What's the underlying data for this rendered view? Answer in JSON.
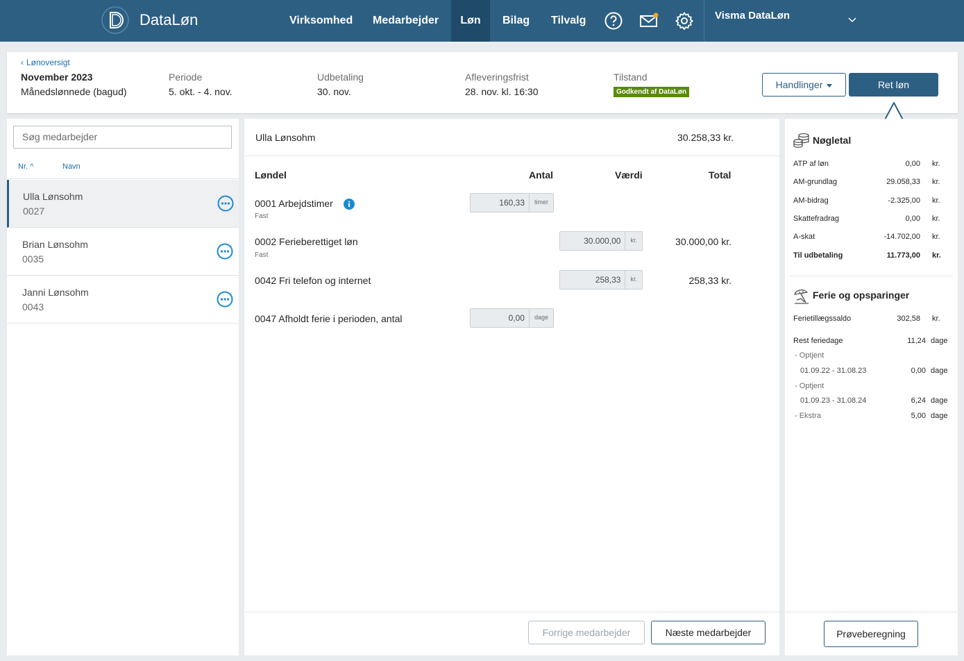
{
  "nav": {
    "brand": "DataLøn",
    "items": [
      "Virksomhed",
      "Medarbejder",
      "Løn",
      "Bilag",
      "Tilvalg"
    ],
    "active_index": 2,
    "icons": [
      "help-icon",
      "mail-icon",
      "settings-icon"
    ],
    "company": "Visma DataLøn",
    "colors": {
      "bar": "#2d5f83",
      "active": "#1f4a69",
      "notification_dot": "#f5a623"
    }
  },
  "header": {
    "back_link": "Lønoversigt",
    "title": "November 2023",
    "subtitle": "Månedslønnede (bagud)",
    "periode_label": "Periode",
    "periode_value": "5. okt. - 4. nov.",
    "udbetaling_label": "Udbetaling",
    "udbetaling_value": "30. nov.",
    "frist_label": "Afleveringsfrist",
    "frist_value": "28. nov. kl. 16:30",
    "tilstand_label": "Tilstand",
    "tilstand_badge": "Godkendt af DataLøn",
    "actions_button": "Handlinger",
    "primary_button": "Ret løn"
  },
  "employees": {
    "search_placeholder": "Søg medarbejder",
    "sort_nr": "Nr.",
    "sort_name": "Navn",
    "list": [
      {
        "name": "Ulla Lønsohm",
        "number": "0027",
        "selected": true
      },
      {
        "name": "Brian Lønsohm",
        "number": "0035",
        "selected": false
      },
      {
        "name": "Janni Lønsohm",
        "number": "0043",
        "selected": false
      }
    ]
  },
  "payslip": {
    "employee": "Ulla Lønsohm",
    "total": "30.258,33 kr.",
    "columns": {
      "londel": "Løndel",
      "antal": "Antal",
      "vaerdi": "Værdi",
      "total": "Total"
    },
    "rows": [
      {
        "label": "0001 Arbejdstimer",
        "sub": "Fast",
        "antal": "160,33",
        "antal_unit": "timer",
        "vaerdi": "",
        "vaerdi_unit": "",
        "total": "",
        "info": true
      },
      {
        "label": "0002 Ferieberettiget løn",
        "sub": "Fast",
        "antal": "",
        "antal_unit": "",
        "vaerdi": "30.000,00",
        "vaerdi_unit": "kr.",
        "total": "30.000,00 kr.",
        "info": false
      },
      {
        "label": "0042 Fri telefon og internet",
        "sub": "",
        "antal": "",
        "antal_unit": "",
        "vaerdi": "258,33",
        "vaerdi_unit": "kr.",
        "total": "258,33 kr.",
        "info": false
      },
      {
        "label": "0047 Afholdt ferie i perioden, antal",
        "sub": "",
        "antal": "0,00",
        "antal_unit": "dage",
        "vaerdi": "",
        "vaerdi_unit": "",
        "total": "",
        "info": false
      }
    ],
    "prev_button": "Forrige medarbejder",
    "next_button": "Næste medarbejder"
  },
  "key_figures": {
    "title": "Nøgletal",
    "items": [
      {
        "label": "ATP af løn",
        "value": "0,00",
        "unit": "kr.",
        "bold": false
      },
      {
        "label": "AM-grundlag",
        "value": "29.058,33",
        "unit": "kr.",
        "bold": false
      },
      {
        "label": "AM-bidrag",
        "value": "-2.325,00",
        "unit": "kr.",
        "bold": false
      },
      {
        "label": "Skattefradrag",
        "value": "0,00",
        "unit": "kr.",
        "bold": false
      },
      {
        "label": "A-skat",
        "value": "-14.702,00",
        "unit": "kr.",
        "bold": false
      },
      {
        "label": "Til udbetaling",
        "value": "11.773,00",
        "unit": "kr.",
        "bold": true
      }
    ]
  },
  "holiday": {
    "title": "Ferie og opsparinger",
    "saldo_label": "Ferietillægssaldo",
    "saldo_value": "302,58",
    "saldo_unit": "kr.",
    "rest_label": "Rest feriedage",
    "rest_value": "11,24",
    "rest_unit": "dage",
    "optjent1_label": "- Optjent",
    "optjent1_period": "01.09.22 - 31.08.23",
    "optjent1_value": "0,00",
    "optjent1_unit": "dage",
    "optjent2_label": "- Optjent",
    "optjent2_period": "01.09.23 - 31.08.24",
    "optjent2_value": "6,24",
    "optjent2_unit": "dage",
    "ekstra_label": "- Ekstra",
    "ekstra_value": "5,00",
    "ekstra_unit": "dage",
    "test_button": "Prøveberegning"
  }
}
